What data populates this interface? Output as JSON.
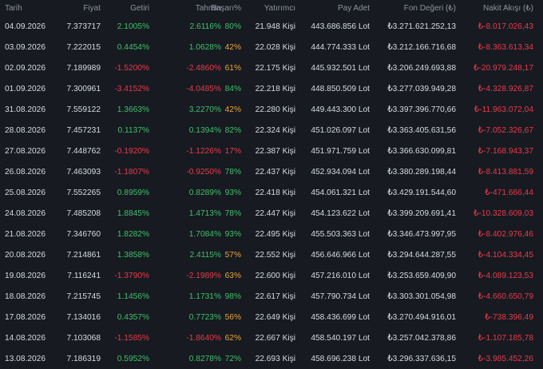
{
  "headers": {
    "date": "Tarih",
    "price": "Fiyat",
    "getiri": "Getiri",
    "tahmin": "Tahmin",
    "basari": "Başarı%",
    "yatirimci": "Yatırımcı",
    "pay": "Pay Adet",
    "fon": "Fon Değeri (₺)",
    "nakit": "Nakit Akışı (₺)"
  },
  "colors": {
    "background": "#171a21",
    "positive": "#3fc06a",
    "negative": "#ea3a4a",
    "warning": "#e9a53a",
    "header_text": "#8d939e"
  },
  "rows": [
    {
      "date": "04.09.2026",
      "price": "7.373717",
      "getiri": "2.1005%",
      "getiri_sign": "pos",
      "tahmin": "2.6116%",
      "tahmin_sign": "pos",
      "basari": "80%",
      "basari_level": "green",
      "yatirimci": "21.948 Kişi",
      "pay": "443.686.856 Lot",
      "fon": "₺3.271.621.252,13",
      "nakit": "₺-8.017.026,43"
    },
    {
      "date": "03.09.2026",
      "price": "7.222015",
      "getiri": "0.4454%",
      "getiri_sign": "pos",
      "tahmin": "1.0628%",
      "tahmin_sign": "pos",
      "basari": "42%",
      "basari_level": "orange",
      "yatirimci": "22.028 Kişi",
      "pay": "444.774.333 Lot",
      "fon": "₺3.212.166.716,68",
      "nakit": "₺-8.363.613,34"
    },
    {
      "date": "02.09.2026",
      "price": "7.189989",
      "getiri": "-1.5200%",
      "getiri_sign": "neg",
      "tahmin": "-2.4860%",
      "tahmin_sign": "neg",
      "basari": "61%",
      "basari_level": "orange",
      "yatirimci": "22.175 Kişi",
      "pay": "445.932.501 Lot",
      "fon": "₺3.206.249.693,88",
      "nakit": "₺-20.979.248,17"
    },
    {
      "date": "01.09.2026",
      "price": "7.300961",
      "getiri": "-3.4152%",
      "getiri_sign": "neg",
      "tahmin": "-4.0485%",
      "tahmin_sign": "neg",
      "basari": "84%",
      "basari_level": "green",
      "yatirimci": "22.218 Kişi",
      "pay": "448.850.509 Lot",
      "fon": "₺3.277.039.949,28",
      "nakit": "₺-4.328.926,87"
    },
    {
      "date": "31.08.2026",
      "price": "7.559122",
      "getiri": "1.3663%",
      "getiri_sign": "pos",
      "tahmin": "3.2270%",
      "tahmin_sign": "pos",
      "basari": "42%",
      "basari_level": "orange",
      "yatirimci": "22.280 Kişi",
      "pay": "449.443.300 Lot",
      "fon": "₺3.397.396.770,66",
      "nakit": "₺-11.963.072,04"
    },
    {
      "date": "28.08.2026",
      "price": "7.457231",
      "getiri": "0.1137%",
      "getiri_sign": "pos",
      "tahmin": "0.1394%",
      "tahmin_sign": "pos",
      "basari": "82%",
      "basari_level": "green",
      "yatirimci": "22.324 Kişi",
      "pay": "451.026.097 Lot",
      "fon": "₺3.363.405.631,56",
      "nakit": "₺-7.052.326,67"
    },
    {
      "date": "27.08.2026",
      "price": "7.448762",
      "getiri": "-0.1920%",
      "getiri_sign": "neg",
      "tahmin": "-1.1226%",
      "tahmin_sign": "neg",
      "basari": "17%",
      "basari_level": "red",
      "yatirimci": "22.387 Kişi",
      "pay": "451.971.759 Lot",
      "fon": "₺3.366.630.099,81",
      "nakit": "₺-7.168.943,37"
    },
    {
      "date": "26.08.2026",
      "price": "7.463093",
      "getiri": "-1.1807%",
      "getiri_sign": "neg",
      "tahmin": "-0.9250%",
      "tahmin_sign": "neg",
      "basari": "78%",
      "basari_level": "green",
      "yatirimci": "22.437 Kişi",
      "pay": "452.934.094 Lot",
      "fon": "₺3.380.289.198,44",
      "nakit": "₺-8.413.881,59"
    },
    {
      "date": "25.08.2026",
      "price": "7.552265",
      "getiri": "0.8959%",
      "getiri_sign": "pos",
      "tahmin": "0.8289%",
      "tahmin_sign": "pos",
      "basari": "93%",
      "basari_level": "green",
      "yatirimci": "22.418 Kişi",
      "pay": "454.061.321 Lot",
      "fon": "₺3.429.191.544,60",
      "nakit": "₺-471.666,44"
    },
    {
      "date": "24.08.2026",
      "price": "7.485208",
      "getiri": "1.8845%",
      "getiri_sign": "pos",
      "tahmin": "1.4713%",
      "tahmin_sign": "pos",
      "basari": "78%",
      "basari_level": "green",
      "yatirimci": "22.447 Kişi",
      "pay": "454.123.622 Lot",
      "fon": "₺3.399.209.691,41",
      "nakit": "₺-10.328.609,03"
    },
    {
      "date": "21.08.2026",
      "price": "7.346760",
      "getiri": "1.8282%",
      "getiri_sign": "pos",
      "tahmin": "1.7084%",
      "tahmin_sign": "pos",
      "basari": "93%",
      "basari_level": "green",
      "yatirimci": "22.495 Kişi",
      "pay": "455.503.363 Lot",
      "fon": "₺3.346.473.997,95",
      "nakit": "₺-8.402.976,46"
    },
    {
      "date": "20.08.2026",
      "price": "7.214861",
      "getiri": "1.3858%",
      "getiri_sign": "pos",
      "tahmin": "2.4115%",
      "tahmin_sign": "pos",
      "basari": "57%",
      "basari_level": "orange",
      "yatirimci": "22.552 Kişi",
      "pay": "456.646.966 Lot",
      "fon": "₺3.294.644.287,55",
      "nakit": "₺-4.104.334,45"
    },
    {
      "date": "19.08.2026",
      "price": "7.116241",
      "getiri": "-1.3790%",
      "getiri_sign": "neg",
      "tahmin": "-2.1989%",
      "tahmin_sign": "neg",
      "basari": "63%",
      "basari_level": "orange",
      "yatirimci": "22.600 Kişi",
      "pay": "457.216.010 Lot",
      "fon": "₺3.253.659.409,90",
      "nakit": "₺-4.089.123,53"
    },
    {
      "date": "18.08.2026",
      "price": "7.215745",
      "getiri": "1.1456%",
      "getiri_sign": "pos",
      "tahmin": "1.1731%",
      "tahmin_sign": "pos",
      "basari": "98%",
      "basari_level": "green",
      "yatirimci": "22.617 Kişi",
      "pay": "457.790.734 Lot",
      "fon": "₺3.303.301.054,98",
      "nakit": "₺-4.660.650,79"
    },
    {
      "date": "17.08.2026",
      "price": "7.134016",
      "getiri": "0.4357%",
      "getiri_sign": "pos",
      "tahmin": "0.7723%",
      "tahmin_sign": "pos",
      "basari": "56%",
      "basari_level": "orange",
      "yatirimci": "22.649 Kişi",
      "pay": "458.436.699 Lot",
      "fon": "₺3.270.494.916,01",
      "nakit": "₺-738.396,49"
    },
    {
      "date": "14.08.2026",
      "price": "7.103068",
      "getiri": "-1.1585%",
      "getiri_sign": "neg",
      "tahmin": "-1.8640%",
      "tahmin_sign": "neg",
      "basari": "62%",
      "basari_level": "orange",
      "yatirimci": "22.667 Kişi",
      "pay": "458.540.197 Lot",
      "fon": "₺3.257.042.378,86",
      "nakit": "₺-1.107.185,78"
    },
    {
      "date": "13.08.2026",
      "price": "7.186319",
      "getiri": "0.5952%",
      "getiri_sign": "pos",
      "tahmin": "0.8278%",
      "tahmin_sign": "pos",
      "basari": "72%",
      "basari_level": "green",
      "yatirimci": "22.693 Kişi",
      "pay": "458.696.238 Lot",
      "fon": "₺3.296.337.636,15",
      "nakit": "₺-3.985.452,26"
    }
  ]
}
